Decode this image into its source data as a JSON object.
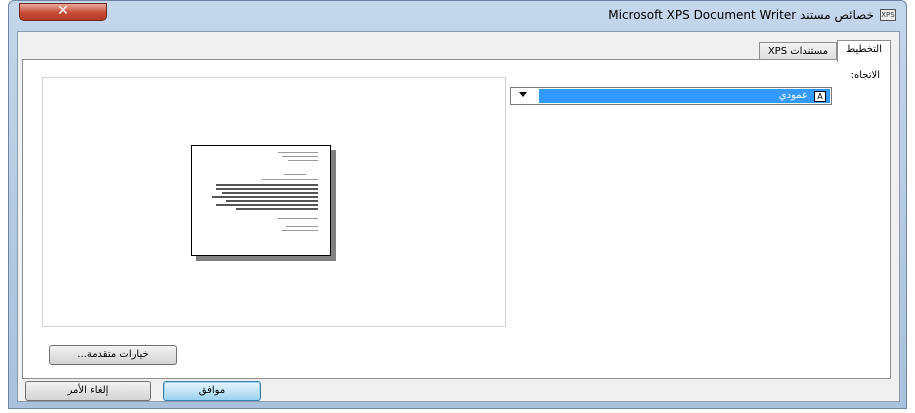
{
  "window": {
    "title": "خصائص مستند Microsoft XPS Document Writer",
    "app_icon_text": "XPS",
    "close_glyph": "✕"
  },
  "tabs": [
    {
      "label": "التخطيط",
      "active": true
    },
    {
      "label": "مستندات XPS",
      "active": false
    }
  ],
  "layout": {
    "orientation_label": "الاتجاه:",
    "orientation_value": "عمودي",
    "orientation_icon": "A",
    "advanced_button": "خيارات متقدمة..."
  },
  "footer": {
    "ok_label": "موافق",
    "cancel_label": "إلغاء الأمر"
  },
  "colors": {
    "accent": "#3399ff",
    "close_button": "#c74a35"
  }
}
